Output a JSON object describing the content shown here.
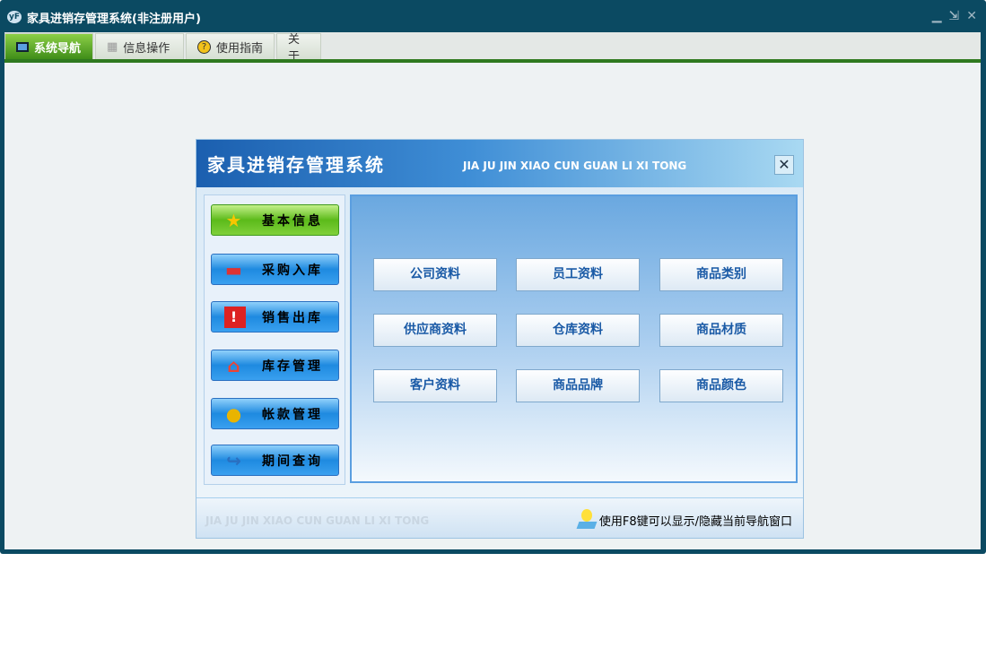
{
  "window": {
    "title": "家具进销存管理系统(非注册用户)",
    "logo": "yF"
  },
  "tabs": [
    {
      "label": "系统导航",
      "icon": "monitor-icon"
    },
    {
      "label": "信息操作",
      "icon": "grid-icon"
    },
    {
      "label": "使用指南",
      "icon": "help-icon"
    },
    {
      "label": "关于"
    }
  ],
  "dialog": {
    "title": "家具进销存管理系统",
    "subtitle": "JIA JU JIN XIAO CUN  GUAN LI XI TONG",
    "close": "✕",
    "nav": [
      {
        "label": "基本信息",
        "icon": "star-icon"
      },
      {
        "label": "采购入库",
        "icon": "monitor-icon"
      },
      {
        "label": "销售出库",
        "icon": "alert-icon"
      },
      {
        "label": "库存管理",
        "icon": "home-icon"
      },
      {
        "label": "帐款管理",
        "icon": "coins-icon"
      },
      {
        "label": "期间查询",
        "icon": "arrow-icon"
      }
    ],
    "grid": [
      "公司资料",
      "员工资料",
      "商品类别",
      "供应商资料",
      "仓库资料",
      "商品材质",
      "客户资料",
      "商品品牌",
      "商品颜色"
    ],
    "footer_sub": "JIA JU JIN XIAO CUN GUAN LI XI TONG",
    "hint": "使用F8键可以显示/隐藏当前导航窗口"
  }
}
